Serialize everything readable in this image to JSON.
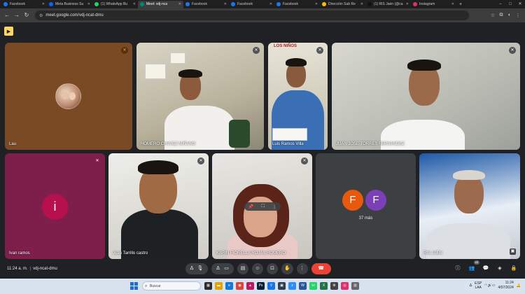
{
  "browser": {
    "tabs": [
      {
        "label": "Facebook",
        "color": "#1877f2",
        "active": false
      },
      {
        "label": "Meta Business Su",
        "color": "#0866ff",
        "active": false
      },
      {
        "label": "(1) WhatsApp Bu",
        "color": "#25d366",
        "active": false
      },
      {
        "label": "Meet: vdj-nca",
        "color": "#00897b",
        "active": true
      },
      {
        "label": "Facebook",
        "color": "#1877f2",
        "active": false
      },
      {
        "label": "Facebook",
        "color": "#1877f2",
        "active": false
      },
      {
        "label": "Facebook",
        "color": "#1877f2",
        "active": false
      },
      {
        "label": "Dirección Sub Re",
        "color": "#fbbc04",
        "active": false
      },
      {
        "label": "(1) RIS Jaén (@ca",
        "color": "#111111",
        "active": false
      },
      {
        "label": "Instagram",
        "color": "#e1306c",
        "active": false
      }
    ],
    "url": "meet.google.com/vdj-ncat-dmu"
  },
  "meet": {
    "participants": [
      {
        "name": "Lau"
      },
      {
        "name": "HOMERO CHAVEZ MIÑANO"
      },
      {
        "name": "Luis Ramos Villa"
      },
      {
        "name": "JUAN JOSE TORRES FERNANDEZ"
      },
      {
        "name": "Ivan ramos",
        "initial": "i"
      },
      {
        "name": "Jean Tarrillo castro"
      },
      {
        "name": "KARIN FIORELLA ROJAS ROMERO"
      },
      {
        "name": "RIS JAEN"
      }
    ],
    "others": {
      "initials": [
        "F",
        "F"
      ],
      "label": "37 más"
    },
    "poster_text": "LOS NIÑOS",
    "time": "11:24 a. m.",
    "meeting_code": "vdj-ncat-dmu",
    "people_count": "45",
    "colors": {
      "end_call": "#ea4335",
      "accent": "#fdd663"
    }
  },
  "taskbar": {
    "search_placeholder": "Buscar",
    "lang": "ESP",
    "lang2": "LAA",
    "clock_time": "11:24",
    "clock_date": "4/07/2024"
  }
}
